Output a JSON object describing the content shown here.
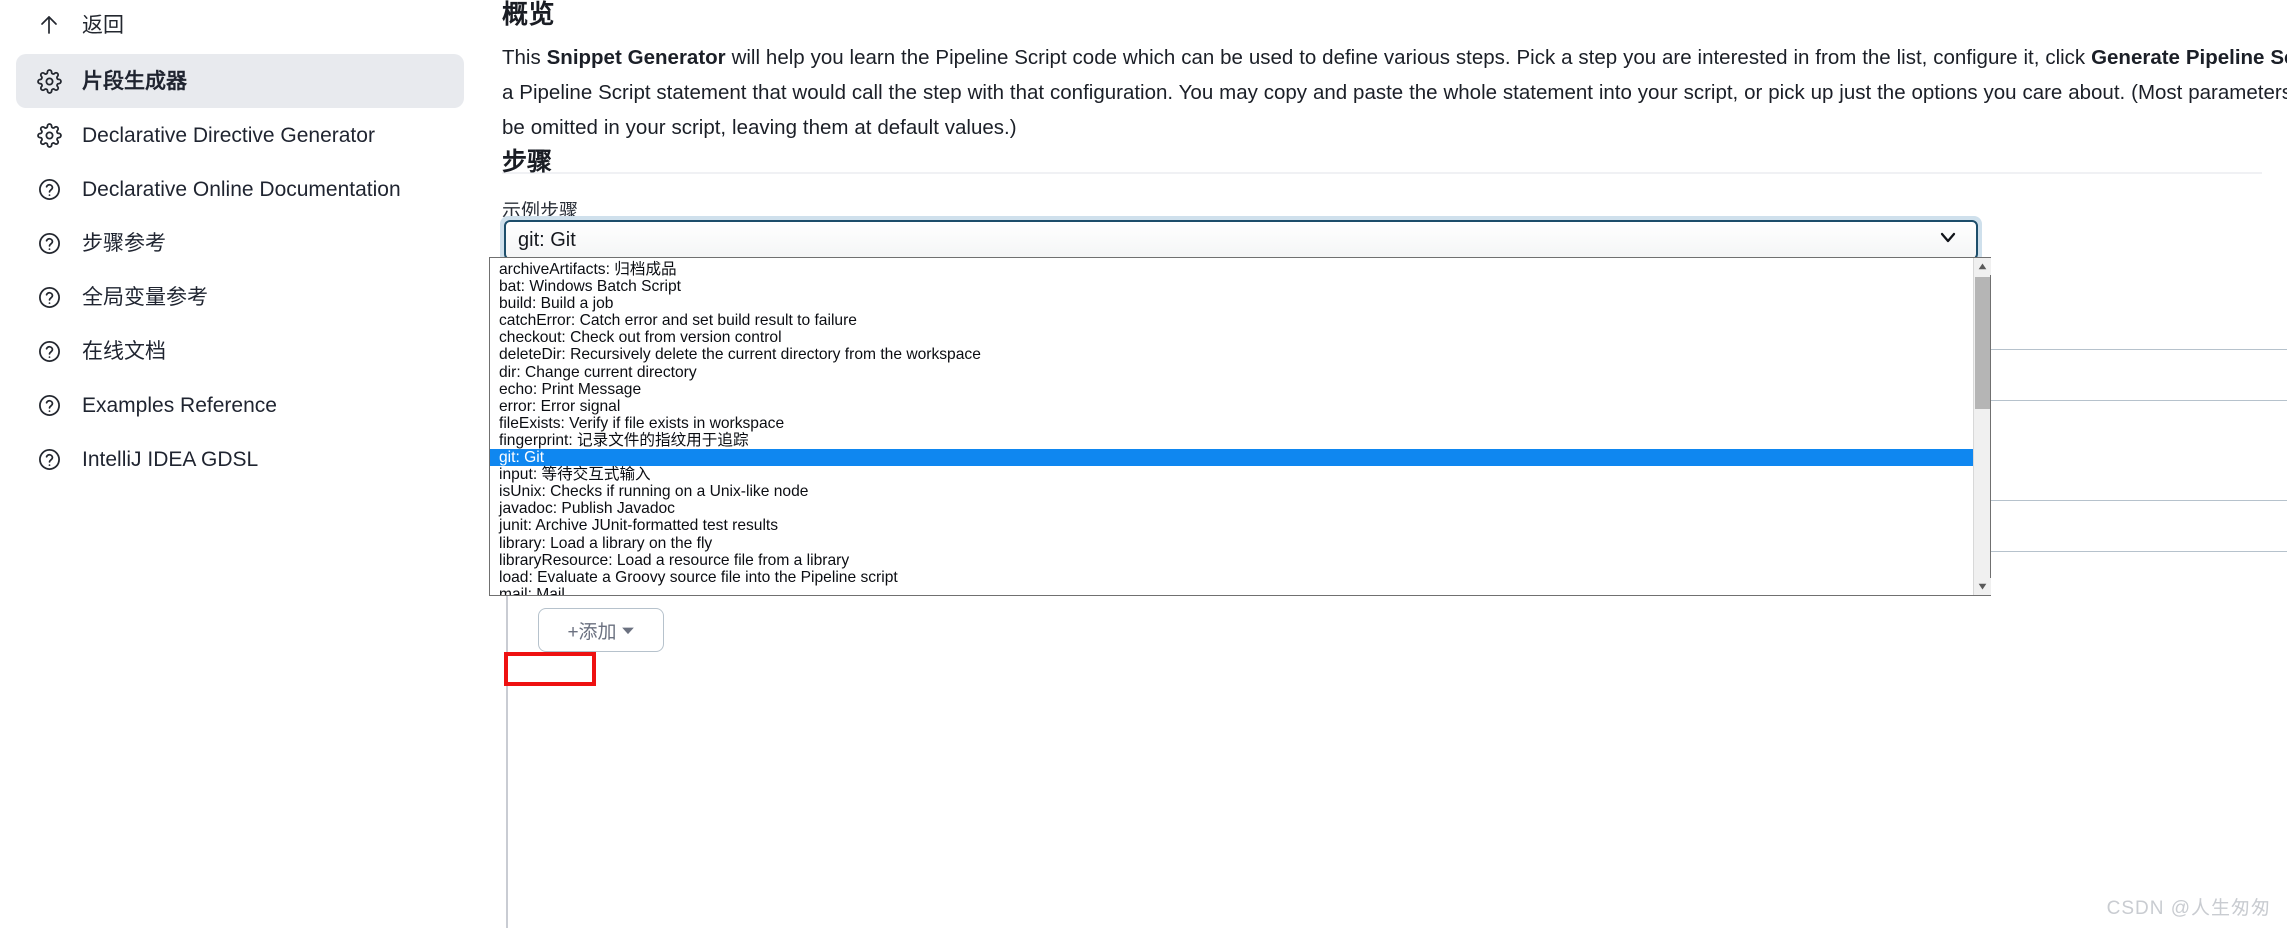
{
  "sidebar": {
    "back": {
      "label": "返回",
      "icon": "arrow-up-icon"
    },
    "items": [
      {
        "label": "片段生成器",
        "icon": "gear-icon",
        "active": true
      },
      {
        "label": "Declarative Directive Generator",
        "icon": "gear-icon",
        "active": false
      },
      {
        "label": "Declarative Online Documentation",
        "icon": "question-circle-icon",
        "active": false
      },
      {
        "label": "步骤参考",
        "icon": "question-circle-icon",
        "active": false
      },
      {
        "label": "全局变量参考",
        "icon": "question-circle-icon",
        "active": false
      },
      {
        "label": "在线文档",
        "icon": "question-circle-icon",
        "active": false
      },
      {
        "label": "Examples Reference",
        "icon": "question-circle-icon",
        "active": false
      },
      {
        "label": "IntelliJ IDEA GDSL",
        "icon": "question-circle-icon",
        "active": false
      }
    ]
  },
  "main": {
    "overview_heading": "概览",
    "overview_paragraph_pre": "This ",
    "overview_paragraph_bold1": "Snippet Generator",
    "overview_paragraph_mid": " will help you learn the Pipeline Script code which can be used to define various steps. Pick a step you are interested in from the list, configure it, click ",
    "overview_paragraph_bold2": "Generate Pipeline Script",
    "overview_paragraph_post": ", and you will see a Pipeline Script statement that would call the step with that configuration. You may copy and paste the whole statement into your script, or pick up just the options you care about. (Most parameters are optional and can be omitted in your script, leaving them at default values.)",
    "steps_heading": "步骤",
    "sample_step_label": "示例步骤",
    "select": {
      "value": "git: Git",
      "chevron_icon": "chevron-down-icon",
      "focused": true
    },
    "add_button": {
      "label": "+添加",
      "caret_icon": "caret-down-icon"
    }
  },
  "dropdown": {
    "open": true,
    "selected_index": 11,
    "highlight_color": "#0f87f0",
    "options": [
      "archiveArtifacts: 归档成品",
      "bat: Windows Batch Script",
      "build: Build a job",
      "catchError: Catch error and set build result to failure",
      "checkout: Check out from version control",
      "deleteDir: Recursively delete the current directory from the workspace",
      "dir: Change current directory",
      "echo: Print Message",
      "error: Error signal",
      "fileExists: Verify if file exists in workspace",
      "fingerprint: 记录文件的指纹用于追踪",
      "git: Git",
      "input: 等待交互式输入",
      "isUnix: Checks if running on a Unix-like node",
      "javadoc: Publish Javadoc",
      "junit: Archive JUnit-formatted test results",
      "library: Load a library on the fly",
      "libraryResource: Load a resource file from a library",
      "load: Evaluate a Groovy source file into the Pipeline script",
      "mail: Mail"
    ],
    "scrollbar": {
      "up_arrow_icon": "triangle-up-icon",
      "down_arrow_icon": "triangle-down-icon"
    }
  },
  "annotation": {
    "color": "#ee1111",
    "target": "git: Git"
  },
  "watermark": {
    "text": "CSDN @人生匆匆"
  }
}
